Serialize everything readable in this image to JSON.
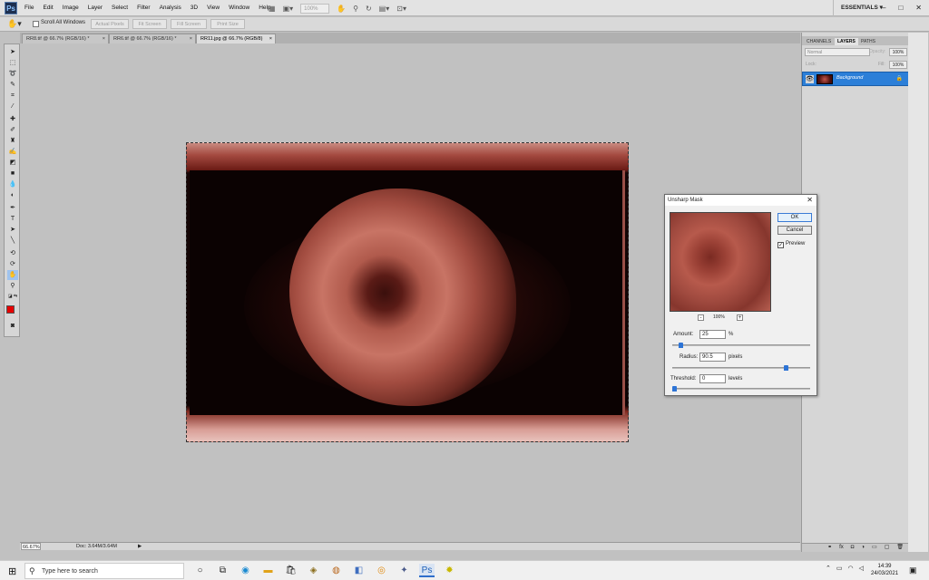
{
  "menubar": {
    "logo": "Ps",
    "items": [
      "File",
      "Edit",
      "Image",
      "Layer",
      "Select",
      "Filter",
      "Analysis",
      "3D",
      "View",
      "Window",
      "Help"
    ],
    "zoom": "100%",
    "workspace": "ESSENTIALS ▾",
    "win_min": "–",
    "win_max": "□",
    "win_close": "✕"
  },
  "options": {
    "scroll_all": "Scroll All Windows",
    "actual_pixels": "Actual Pixels",
    "fit_screen": "Fit Screen",
    "fill_screen": "Fill Screen",
    "print_size": "Print Size"
  },
  "tabs": [
    {
      "label": "RR8.tif @ 66.7% (RGB/16) *"
    },
    {
      "label": "RR6.tif @ 66.7% (RGB/16) *"
    },
    {
      "label": "RR11.jpg @ 66.7% (RGB/8)"
    }
  ],
  "tab_close": "×",
  "status": {
    "zoom": "66.67%",
    "doc": "Doc: 3.64M/3.64M",
    "arrow": "▶"
  },
  "panel": {
    "tabs": [
      "CHANNELS",
      "LAYERS",
      "PATHS"
    ],
    "blend_mode": "Normal",
    "opacity_label": "Opacity:",
    "opacity": "100%",
    "lock_label": "Lock:",
    "fill_label": "Fill:",
    "fill": "100%",
    "layer_name": "Background"
  },
  "dialog": {
    "title": "Unsharp Mask",
    "ok": "OK",
    "cancel": "Cancel",
    "preview_label": "Preview",
    "preview_checked": true,
    "preview_zoom": "100%",
    "amount_label": "Amount:",
    "amount": "25",
    "amount_unit": "%",
    "amount_fraction": 0.05,
    "radius_label": "Radius:",
    "radius": "90.5",
    "radius_unit": "pixels",
    "radius_fraction": 0.84,
    "threshold_label": "Threshold:",
    "threshold": "0",
    "threshold_unit": "levels",
    "threshold_fraction": 0.0
  },
  "taskbar": {
    "search_placeholder": "Type here to search",
    "time": "14:39",
    "date": "24/03/2021"
  }
}
